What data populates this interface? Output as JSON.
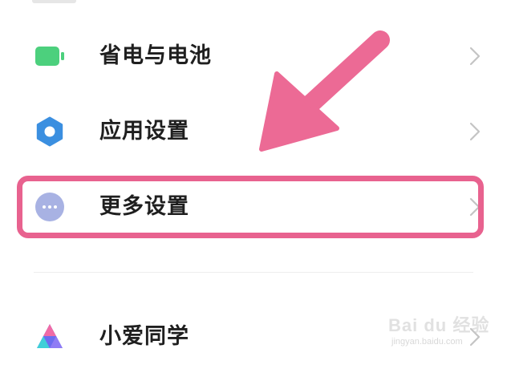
{
  "settings": {
    "items": [
      {
        "label": "省电与电池",
        "icon": "battery-icon",
        "icon_color": "#4cd07d"
      },
      {
        "label": "应用设置",
        "icon": "gear-icon",
        "icon_color": "#3b8fe0"
      },
      {
        "label": "更多设置",
        "icon": "more-dots-icon",
        "icon_color": "#a8b2e3"
      },
      {
        "label": "小爱同学",
        "icon": "xiaoai-icon",
        "icon_color": "#6b6cf0"
      }
    ]
  },
  "annotation": {
    "highlight_color": "#e8628f",
    "arrow_color": "#ec6a95"
  },
  "watermark": {
    "text": "Bai du 经验",
    "subtext": "jingyan.baidu.com"
  }
}
